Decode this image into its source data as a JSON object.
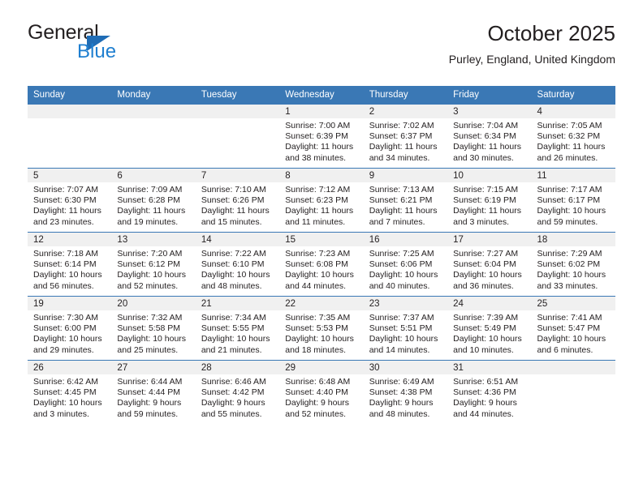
{
  "brand": {
    "name_top": "General",
    "name_bottom": "Blue",
    "triangle_color": "#1f6cb5",
    "blue_color": "#1f7fd0"
  },
  "header": {
    "title": "October 2025",
    "subtitle": "Purley, England, United Kingdom"
  },
  "theme": {
    "header_blue": "#3a78b5",
    "daynum_band": "#f0f0f0",
    "text": "#231f20"
  },
  "weekdays": [
    "Sunday",
    "Monday",
    "Tuesday",
    "Wednesday",
    "Thursday",
    "Friday",
    "Saturday"
  ],
  "weeks": [
    [
      {
        "day": "",
        "blank": true
      },
      {
        "day": "",
        "blank": true
      },
      {
        "day": "",
        "blank": true
      },
      {
        "day": "1",
        "sunrise": "Sunrise: 7:00 AM",
        "sunset": "Sunset: 6:39 PM",
        "daylight_line1": "Daylight: 11 hours",
        "daylight_line2": "and 38 minutes."
      },
      {
        "day": "2",
        "sunrise": "Sunrise: 7:02 AM",
        "sunset": "Sunset: 6:37 PM",
        "daylight_line1": "Daylight: 11 hours",
        "daylight_line2": "and 34 minutes."
      },
      {
        "day": "3",
        "sunrise": "Sunrise: 7:04 AM",
        "sunset": "Sunset: 6:34 PM",
        "daylight_line1": "Daylight: 11 hours",
        "daylight_line2": "and 30 minutes."
      },
      {
        "day": "4",
        "sunrise": "Sunrise: 7:05 AM",
        "sunset": "Sunset: 6:32 PM",
        "daylight_line1": "Daylight: 11 hours",
        "daylight_line2": "and 26 minutes."
      }
    ],
    [
      {
        "day": "5",
        "sunrise": "Sunrise: 7:07 AM",
        "sunset": "Sunset: 6:30 PM",
        "daylight_line1": "Daylight: 11 hours",
        "daylight_line2": "and 23 minutes."
      },
      {
        "day": "6",
        "sunrise": "Sunrise: 7:09 AM",
        "sunset": "Sunset: 6:28 PM",
        "daylight_line1": "Daylight: 11 hours",
        "daylight_line2": "and 19 minutes."
      },
      {
        "day": "7",
        "sunrise": "Sunrise: 7:10 AM",
        "sunset": "Sunset: 6:26 PM",
        "daylight_line1": "Daylight: 11 hours",
        "daylight_line2": "and 15 minutes."
      },
      {
        "day": "8",
        "sunrise": "Sunrise: 7:12 AM",
        "sunset": "Sunset: 6:23 PM",
        "daylight_line1": "Daylight: 11 hours",
        "daylight_line2": "and 11 minutes."
      },
      {
        "day": "9",
        "sunrise": "Sunrise: 7:13 AM",
        "sunset": "Sunset: 6:21 PM",
        "daylight_line1": "Daylight: 11 hours",
        "daylight_line2": "and 7 minutes."
      },
      {
        "day": "10",
        "sunrise": "Sunrise: 7:15 AM",
        "sunset": "Sunset: 6:19 PM",
        "daylight_line1": "Daylight: 11 hours",
        "daylight_line2": "and 3 minutes."
      },
      {
        "day": "11",
        "sunrise": "Sunrise: 7:17 AM",
        "sunset": "Sunset: 6:17 PM",
        "daylight_line1": "Daylight: 10 hours",
        "daylight_line2": "and 59 minutes."
      }
    ],
    [
      {
        "day": "12",
        "sunrise": "Sunrise: 7:18 AM",
        "sunset": "Sunset: 6:14 PM",
        "daylight_line1": "Daylight: 10 hours",
        "daylight_line2": "and 56 minutes."
      },
      {
        "day": "13",
        "sunrise": "Sunrise: 7:20 AM",
        "sunset": "Sunset: 6:12 PM",
        "daylight_line1": "Daylight: 10 hours",
        "daylight_line2": "and 52 minutes."
      },
      {
        "day": "14",
        "sunrise": "Sunrise: 7:22 AM",
        "sunset": "Sunset: 6:10 PM",
        "daylight_line1": "Daylight: 10 hours",
        "daylight_line2": "and 48 minutes."
      },
      {
        "day": "15",
        "sunrise": "Sunrise: 7:23 AM",
        "sunset": "Sunset: 6:08 PM",
        "daylight_line1": "Daylight: 10 hours",
        "daylight_line2": "and 44 minutes."
      },
      {
        "day": "16",
        "sunrise": "Sunrise: 7:25 AM",
        "sunset": "Sunset: 6:06 PM",
        "daylight_line1": "Daylight: 10 hours",
        "daylight_line2": "and 40 minutes."
      },
      {
        "day": "17",
        "sunrise": "Sunrise: 7:27 AM",
        "sunset": "Sunset: 6:04 PM",
        "daylight_line1": "Daylight: 10 hours",
        "daylight_line2": "and 36 minutes."
      },
      {
        "day": "18",
        "sunrise": "Sunrise: 7:29 AM",
        "sunset": "Sunset: 6:02 PM",
        "daylight_line1": "Daylight: 10 hours",
        "daylight_line2": "and 33 minutes."
      }
    ],
    [
      {
        "day": "19",
        "sunrise": "Sunrise: 7:30 AM",
        "sunset": "Sunset: 6:00 PM",
        "daylight_line1": "Daylight: 10 hours",
        "daylight_line2": "and 29 minutes."
      },
      {
        "day": "20",
        "sunrise": "Sunrise: 7:32 AM",
        "sunset": "Sunset: 5:58 PM",
        "daylight_line1": "Daylight: 10 hours",
        "daylight_line2": "and 25 minutes."
      },
      {
        "day": "21",
        "sunrise": "Sunrise: 7:34 AM",
        "sunset": "Sunset: 5:55 PM",
        "daylight_line1": "Daylight: 10 hours",
        "daylight_line2": "and 21 minutes."
      },
      {
        "day": "22",
        "sunrise": "Sunrise: 7:35 AM",
        "sunset": "Sunset: 5:53 PM",
        "daylight_line1": "Daylight: 10 hours",
        "daylight_line2": "and 18 minutes."
      },
      {
        "day": "23",
        "sunrise": "Sunrise: 7:37 AM",
        "sunset": "Sunset: 5:51 PM",
        "daylight_line1": "Daylight: 10 hours",
        "daylight_line2": "and 14 minutes."
      },
      {
        "day": "24",
        "sunrise": "Sunrise: 7:39 AM",
        "sunset": "Sunset: 5:49 PM",
        "daylight_line1": "Daylight: 10 hours",
        "daylight_line2": "and 10 minutes."
      },
      {
        "day": "25",
        "sunrise": "Sunrise: 7:41 AM",
        "sunset": "Sunset: 5:47 PM",
        "daylight_line1": "Daylight: 10 hours",
        "daylight_line2": "and 6 minutes."
      }
    ],
    [
      {
        "day": "26",
        "sunrise": "Sunrise: 6:42 AM",
        "sunset": "Sunset: 4:45 PM",
        "daylight_line1": "Daylight: 10 hours",
        "daylight_line2": "and 3 minutes."
      },
      {
        "day": "27",
        "sunrise": "Sunrise: 6:44 AM",
        "sunset": "Sunset: 4:44 PM",
        "daylight_line1": "Daylight: 9 hours",
        "daylight_line2": "and 59 minutes."
      },
      {
        "day": "28",
        "sunrise": "Sunrise: 6:46 AM",
        "sunset": "Sunset: 4:42 PM",
        "daylight_line1": "Daylight: 9 hours",
        "daylight_line2": "and 55 minutes."
      },
      {
        "day": "29",
        "sunrise": "Sunrise: 6:48 AM",
        "sunset": "Sunset: 4:40 PM",
        "daylight_line1": "Daylight: 9 hours",
        "daylight_line2": "and 52 minutes."
      },
      {
        "day": "30",
        "sunrise": "Sunrise: 6:49 AM",
        "sunset": "Sunset: 4:38 PM",
        "daylight_line1": "Daylight: 9 hours",
        "daylight_line2": "and 48 minutes."
      },
      {
        "day": "31",
        "sunrise": "Sunrise: 6:51 AM",
        "sunset": "Sunset: 4:36 PM",
        "daylight_line1": "Daylight: 9 hours",
        "daylight_line2": "and 44 minutes."
      },
      {
        "day": "",
        "blank": true
      }
    ]
  ]
}
